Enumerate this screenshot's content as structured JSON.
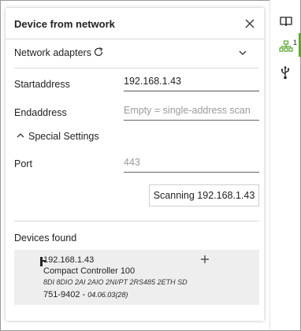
{
  "dialog": {
    "title": "Device from network",
    "network_adapters_label": "Network adapters",
    "start_label": "Startaddress",
    "start_value": "192.168.1.43",
    "end_label": "Endaddress",
    "end_placeholder": "Empty = single-address scan",
    "special_label": "Special Settings",
    "port_label": "Port",
    "port_placeholder": "443",
    "scan_button": "Scanning 192.168.1.43",
    "devices_label": "Devices found"
  },
  "devices": [
    {
      "ip": "192.168.1.43",
      "name": "Compact Controller 100",
      "spec": "8DI 8DIO 2AI 2AIO 2NI/PT 2RS485 2ETH SD",
      "article": "751-9402",
      "separator": " - ",
      "version": "04.06.03(28)"
    }
  ],
  "sidebar": {
    "network_badge": "1",
    "icons": [
      "book-icon",
      "network-icon",
      "usb-icon"
    ],
    "active_color": "#5aa832"
  },
  "icons": {
    "close": "close-icon",
    "refresh": "refresh-icon",
    "dropdown": "chevron-down-icon",
    "collapse": "chevron-up-icon",
    "device": "device-icon",
    "add": "plus-icon"
  }
}
